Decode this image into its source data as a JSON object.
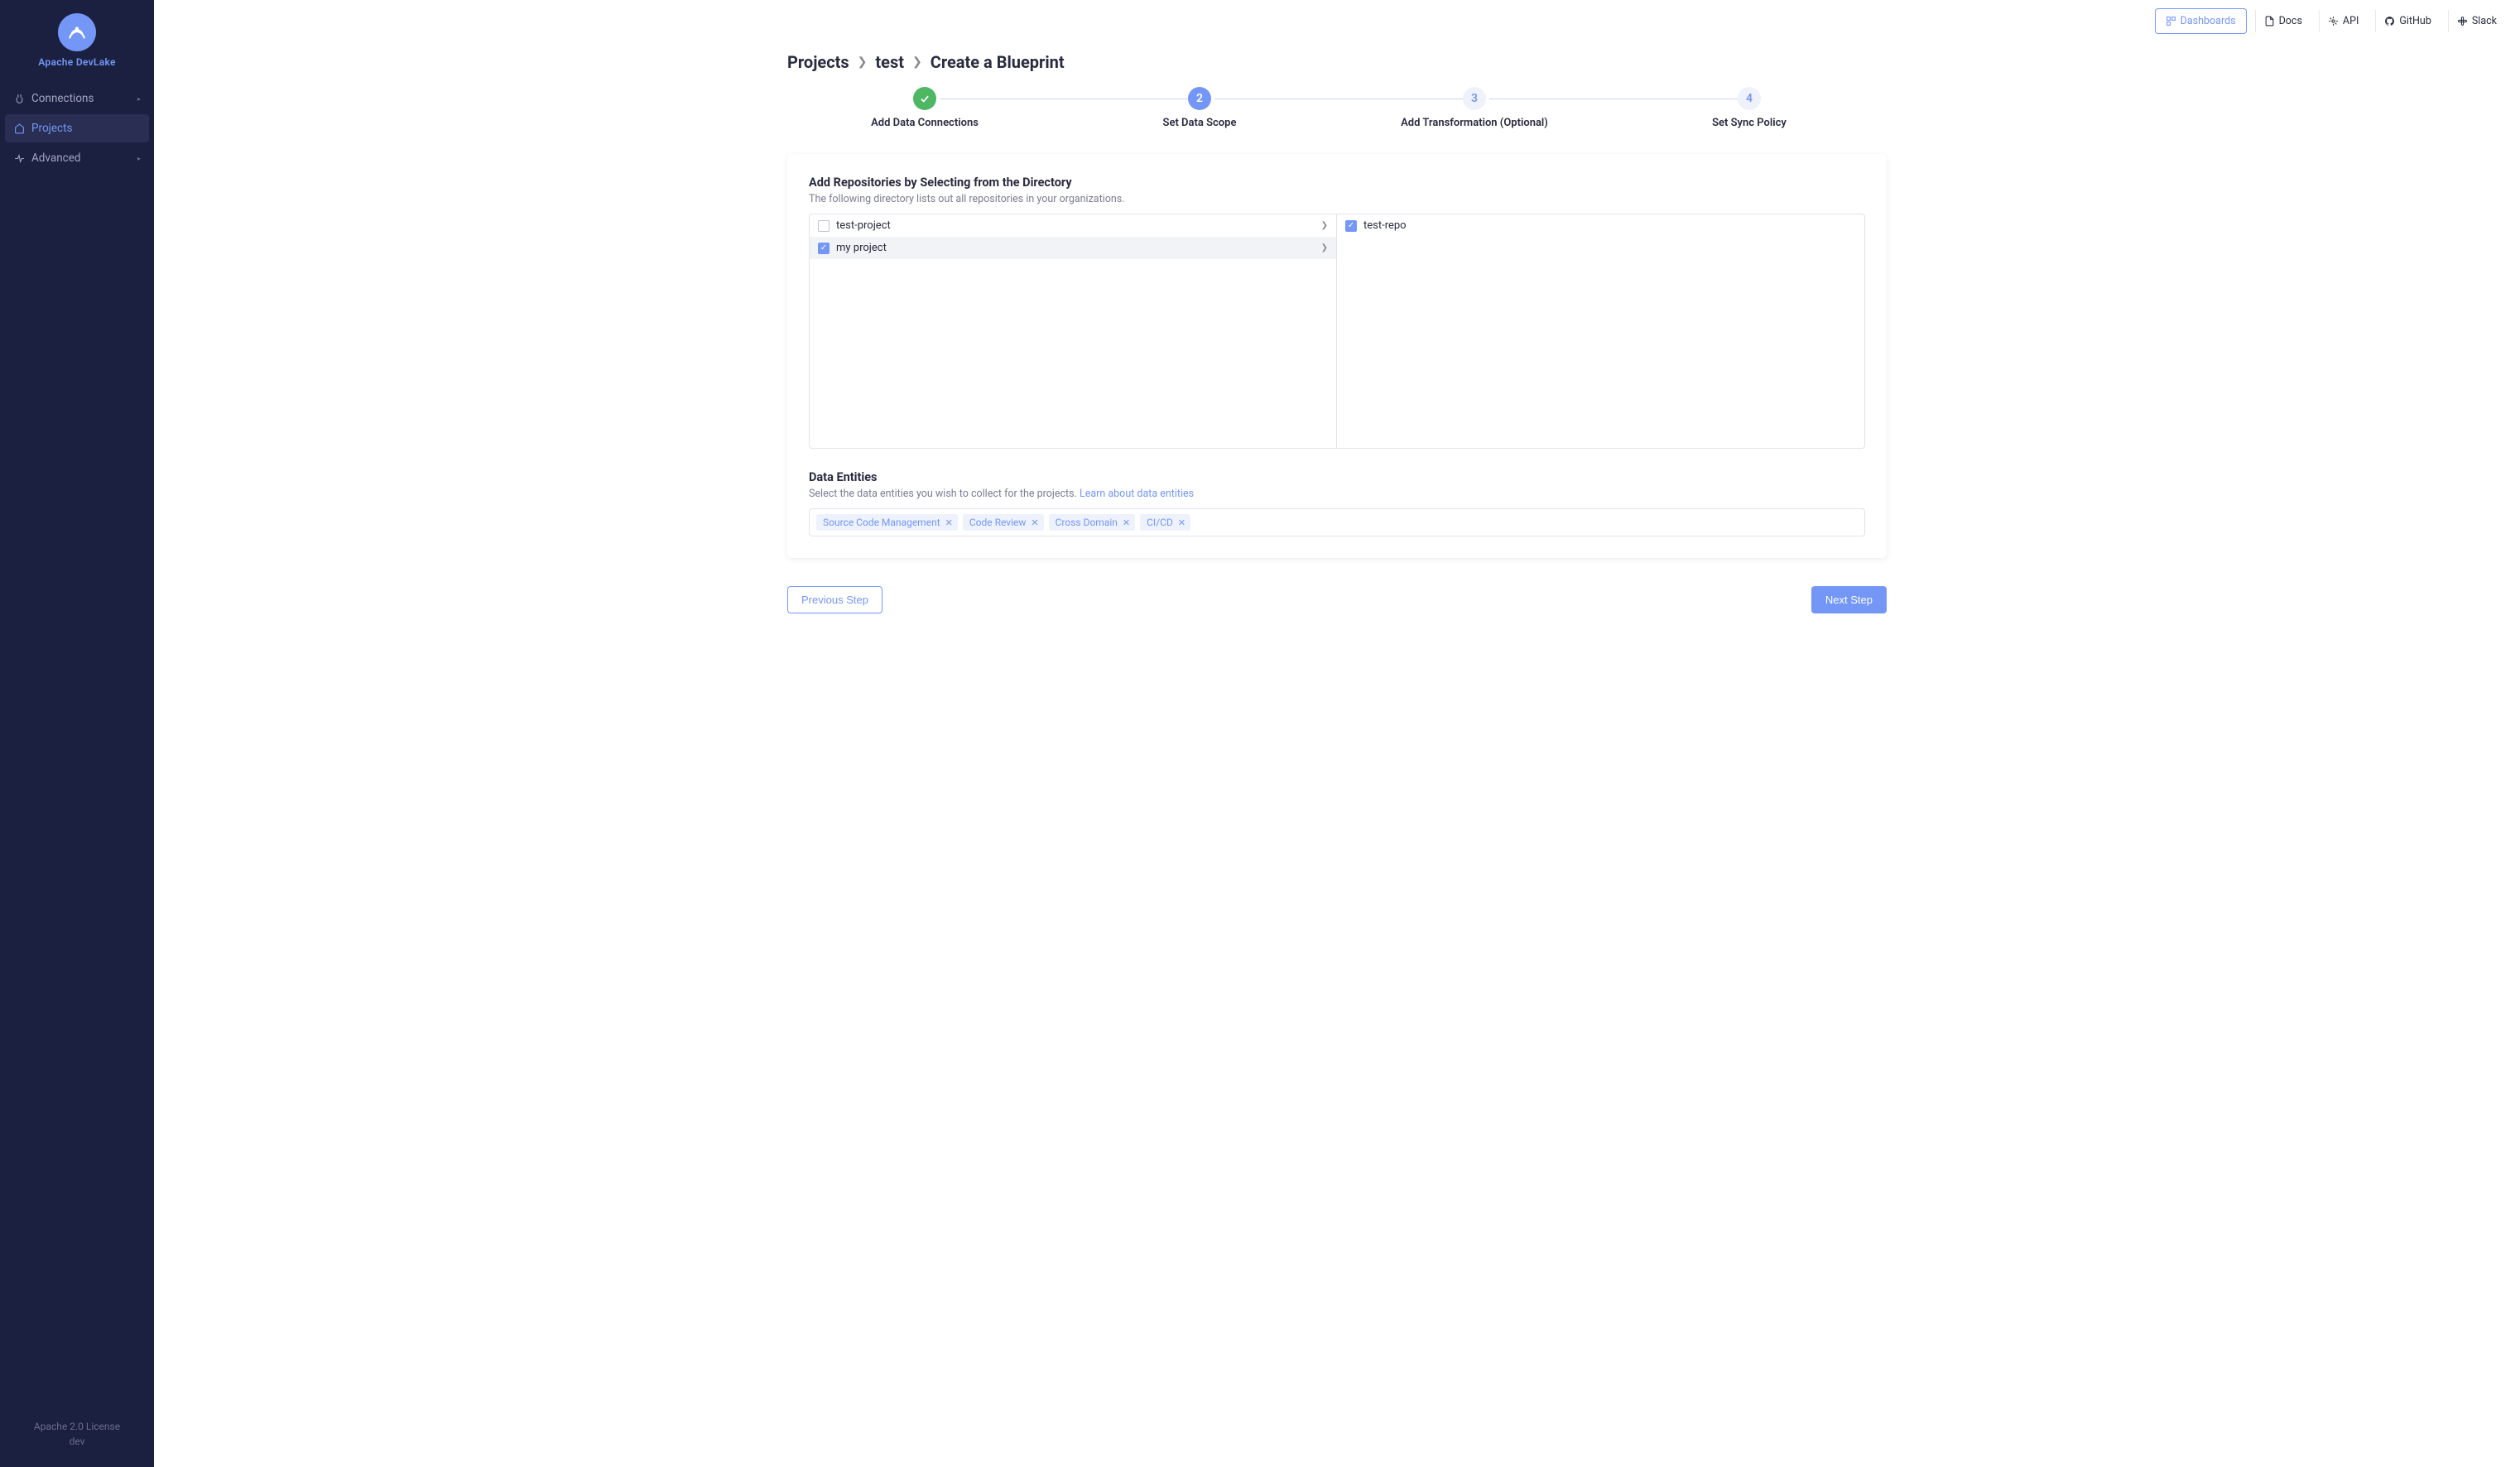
{
  "logo": {
    "name": "Apache DevLake"
  },
  "nav": {
    "items": [
      {
        "label": "Connections",
        "icon": "plug-icon",
        "expandable": true,
        "active": false
      },
      {
        "label": "Projects",
        "icon": "home-icon",
        "expandable": false,
        "active": true
      },
      {
        "label": "Advanced",
        "icon": "pulse-icon",
        "expandable": true,
        "active": false
      }
    ]
  },
  "footer": {
    "license": "Apache 2.0 License",
    "version": "dev"
  },
  "topbar": {
    "dashboards": "Dashboards",
    "docs": "Docs",
    "api": "API",
    "github": "GitHub",
    "slack": "Slack"
  },
  "breadcrumb": {
    "items": [
      "Projects",
      "test",
      "Create a Blueprint"
    ]
  },
  "stepper": {
    "steps": [
      {
        "label": "Add Data Connections",
        "state": "done"
      },
      {
        "label": "Set Data Scope",
        "num": "2",
        "state": "active"
      },
      {
        "label": "Add Transformation (Optional)",
        "num": "3",
        "state": "pending"
      },
      {
        "label": "Set Sync Policy",
        "num": "4",
        "state": "pending"
      }
    ]
  },
  "repos": {
    "title": "Add Repositories by Selecting from the Directory",
    "subtitle": "The following directory lists out all repositories in your organizations.",
    "left": [
      {
        "label": "test-project",
        "checked": false,
        "selected": false
      },
      {
        "label": "my project",
        "checked": true,
        "selected": true
      }
    ],
    "right": [
      {
        "label": "test-repo",
        "checked": true
      }
    ]
  },
  "entities": {
    "title": "Data Entities",
    "subtitle_prefix": "Select the data entities you wish to collect for the projects. ",
    "link": "Learn about data entities",
    "tags": [
      "Source Code Management",
      "Code Review",
      "Cross Domain",
      "CI/CD"
    ]
  },
  "actions": {
    "prev": "Previous Step",
    "next": "Next Step"
  }
}
